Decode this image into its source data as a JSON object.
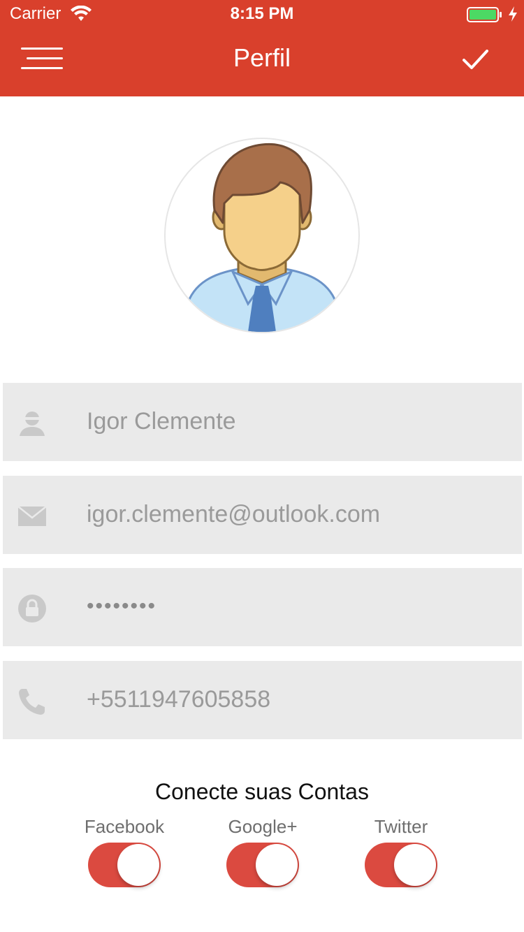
{
  "status_bar": {
    "carrier": "Carrier",
    "time": "8:15 PM"
  },
  "nav": {
    "title": "Perfil",
    "menu_icon": "hamburger-menu-icon",
    "confirm_icon": "checkmark-icon"
  },
  "profile": {
    "avatar_icon": "user-avatar-icon"
  },
  "fields": {
    "name": {
      "icon": "user-icon",
      "value": "Igor Clemente"
    },
    "email": {
      "icon": "envelope-icon",
      "value": "igor.clemente@outlook.com"
    },
    "password": {
      "icon": "lock-icon",
      "value": "••••••••"
    },
    "phone": {
      "icon": "phone-icon",
      "value": "+5511947605858"
    }
  },
  "connect": {
    "title": "Conecte suas Contas",
    "accounts": [
      {
        "label": "Facebook",
        "enabled": true
      },
      {
        "label": "Google+",
        "enabled": true
      },
      {
        "label": "Twitter",
        "enabled": true
      }
    ]
  },
  "colors": {
    "brand": "#d9402c",
    "toggle_on": "#db4a40",
    "field_bg": "#eaeaea"
  }
}
